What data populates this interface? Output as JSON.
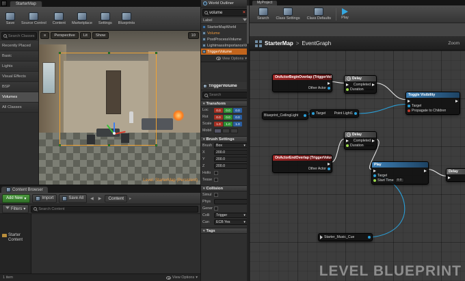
{
  "level_editor": {
    "window_tab": "StarterMap",
    "toolbar": [
      "Save",
      "Source Control",
      "Content",
      "Marketplace",
      "Settings",
      "Blueprints"
    ],
    "modes_search_placeholder": "Search Classes",
    "modes_items": [
      "Recently Placed",
      "Basic",
      "Lights",
      "Visual Effects",
      "BSP",
      "Volumes",
      "All Classes"
    ],
    "viewport": {
      "menu_glyph": "≡",
      "perspective": "Perspective",
      "lit": "Lit",
      "show": "Show",
      "camera_speed": "10",
      "status": "Level: StarterMap (Persistent)"
    },
    "content_browser": {
      "tab": "Content Browser",
      "add_new": "Add New",
      "import": "Import",
      "save_all": "Save All",
      "breadcrumb": "Content",
      "filters": "Filters",
      "search_placeholder": "Search Content",
      "tree_folder": "Starter Content",
      "item_count": "1 item",
      "view_options": "View Options"
    }
  },
  "world_outliner": {
    "title": "World Outliner",
    "search_value": "volume",
    "column_label": "Label",
    "rows": [
      "StarterMapWorld",
      "Volume",
      "PostProcessVolume",
      "LightmassImportanceVolume",
      "TriggerVolume"
    ],
    "view_options": "View Options"
  },
  "details": {
    "name_value": "TriggerVolume",
    "search_placeholder": "Search",
    "transform_title": "Transform",
    "loc_label": "Loc",
    "rot_label": "Rot",
    "scale_label": "Scale",
    "mobility_label": "Mobil",
    "loc": {
      "x": "0.0",
      "y": "0.0",
      "z": "0.0"
    },
    "rot": {
      "x": "0.0",
      "y": "0.0",
      "z": "0.0"
    },
    "scale": {
      "x": "1.0",
      "y": "1.0",
      "z": "1.0"
    },
    "brush_title": "Brush Settings",
    "brush_label": "Brush",
    "brush_value": "Box",
    "x_label": "X",
    "x_value": "200.0",
    "y_label": "Y",
    "y_value": "200.0",
    "z_label": "Z",
    "z_value": "200.0",
    "hollow_label": "Hollo",
    "tessellated_label": "Tesse",
    "collision_title": "Collision",
    "simulate_label": "Simul",
    "physics_label": "Phys",
    "generate_label": "Gener",
    "presets_label": "Colli",
    "presets_value": "Trigger",
    "stepup_label": "Can",
    "stepup_value": "ECB Yes",
    "tags_title": "Tags"
  },
  "blueprint": {
    "window_tab": "MyProject",
    "toolbar": [
      "Search",
      "Class Settings",
      "Class Defaults",
      "Play"
    ],
    "breadcrumb_root": "StarterMap",
    "breadcrumb_sep": ">",
    "breadcrumb_current": "EventGraph",
    "zoom_label": "Zoom",
    "watermark": "LEVEL BLUEPRINT",
    "nodes": {
      "begin_overlap": {
        "title": "OnActorBeginOverlap (TriggerVolume)",
        "other_actor": "Other Actor"
      },
      "delay1": {
        "title": "Delay",
        "completed": "Completed",
        "duration": "Duration"
      },
      "toggle_visibility": {
        "title": "Toggle Visibility",
        "target": "Target",
        "propagate": "Propagate to Children"
      },
      "ceiling_light": {
        "title": "Blueprint_CeilingLight"
      },
      "point_light": {
        "target": "Target",
        "output": "Point Light1"
      },
      "delay2": {
        "title": "Delay",
        "completed": "Completed",
        "duration": "Duration"
      },
      "end_overlap": {
        "title": "OnActorEndOverlap (TriggerVolume)",
        "other_actor": "Other Actor"
      },
      "play": {
        "title": "Play",
        "target": "Target",
        "start_time": "Start Time",
        "start_time_value": "0.0"
      },
      "music_cue": {
        "title": "Starter_Music_Cue"
      },
      "edge": {
        "title": "Delay"
      }
    }
  }
}
